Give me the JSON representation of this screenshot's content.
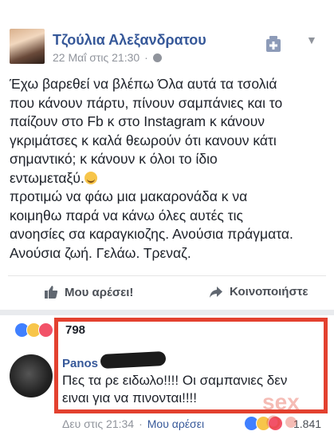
{
  "post": {
    "author": "Τζούλια Αλεξανδρατου",
    "date": "22 Μαΐ στις 21:30",
    "separator": "·",
    "text_before_emoji": "Έχω βαρεθεί να βλέπω Όλα αυτά τα τσολιά\nπου κάνουν πάρτυ, πίνουν σαμπάνιες και το\nπαίζουν στο Fb κ στο Instagram κ κάνουν\nγκριμάτσες κ καλά θεωρούν ότι κανουν κάτι\nσημαντικό; κ κάνουν κ όλοι το ίδιο\nεντωμεταξύ.",
    "text_after_emoji": "\nπροτιμώ να φάω μια μακαρονάδα κ να\nκοιμηθω παρά να κάνω όλες αυτές τις\nανοησίες σα καραγκιοζης. Ανούσια πράγματα.\nΑνούσια ζωή. Γελάω. Τρεναζ."
  },
  "actions": {
    "like_label": "Μου αρέσει!",
    "share_label": "Κοινοποιήστε"
  },
  "reactions": {
    "count": "798"
  },
  "comment": {
    "author": "Panos",
    "text": "Πες τα ρε ειδωλο!!!! Οι σαμπανιες δεν\nειναι για να πινονται!!!!",
    "date": "Δευ στις 21:34",
    "separator": "·",
    "like_link": "Μου αρέσει",
    "reaction_count": "1.841"
  },
  "colors": {
    "link_blue": "#365899",
    "highlight_red": "#e3412f",
    "meta_gray": "#90949c"
  },
  "icons": {
    "globe": "globe-icon",
    "like": "thumbs-up-icon",
    "share": "share-arrow-icon",
    "bookmark": "add-badge-icon",
    "menu": "chevron-down-icon"
  }
}
